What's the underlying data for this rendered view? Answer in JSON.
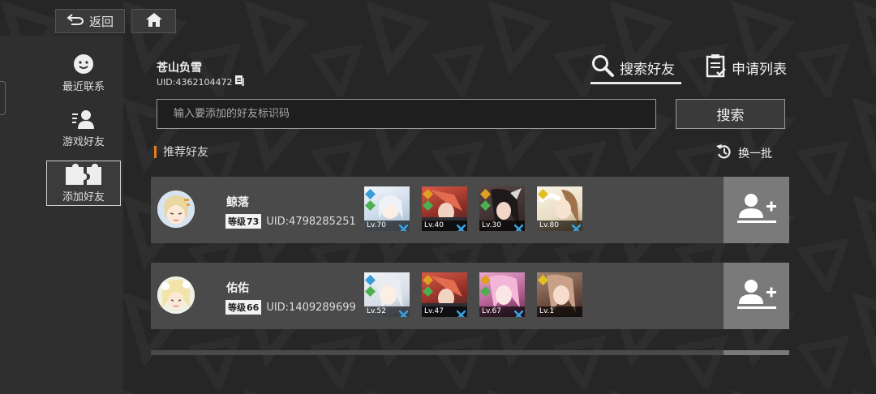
{
  "nav": {
    "back_label": "返回",
    "back_icon": "back-arrow-icon",
    "home_icon": "home-icon"
  },
  "sidebar": {
    "items": [
      {
        "label": "最近联系",
        "icon": "smiley-icon",
        "active": false
      },
      {
        "label": "游戏好友",
        "icon": "friends-icon",
        "active": false
      },
      {
        "label": "添加好友",
        "icon": "puzzle-icon",
        "active": true
      }
    ]
  },
  "profile": {
    "name": "苍山负雪",
    "uid": "UID:4362104472",
    "copy_icon": "copy-icon"
  },
  "tabs": {
    "search_label": "搜索好友",
    "requests_label": "申请列表"
  },
  "search": {
    "placeholder": "输入要添加的好友标识码",
    "button_label": "搜索"
  },
  "recommend": {
    "title": "推荐好友",
    "refresh_label": "换一批"
  },
  "friends": [
    {
      "name": "鲸落",
      "level_prefix": "等级",
      "level": "73",
      "uid": "UID:4798285251",
      "characters": [
        {
          "level": "Lv.70",
          "color": "#c7d7e8"
        },
        {
          "level": "Lv.40",
          "color": "#b9473c"
        },
        {
          "level": "Lv.30",
          "color": "#4a3a3a"
        },
        {
          "level": "Lv.80",
          "color": "#e8dcc4"
        }
      ]
    },
    {
      "name": "佑佑",
      "level_prefix": "等级",
      "level": "66",
      "uid": "UID:1409289699",
      "characters": [
        {
          "level": "Lv.52",
          "color": "#d6dde6"
        },
        {
          "level": "Lv.47",
          "color": "#b9473c"
        },
        {
          "level": "Lv.67",
          "color": "#d98fb8"
        },
        {
          "level": "Lv.1",
          "color": "#8a6a58"
        }
      ]
    }
  ],
  "colors": {
    "accent": "#e0801f",
    "card": "#4a4a4a",
    "add_button": "#7a7a7a",
    "element_green": "#4caf50",
    "element_blue": "#3a9bd9"
  }
}
